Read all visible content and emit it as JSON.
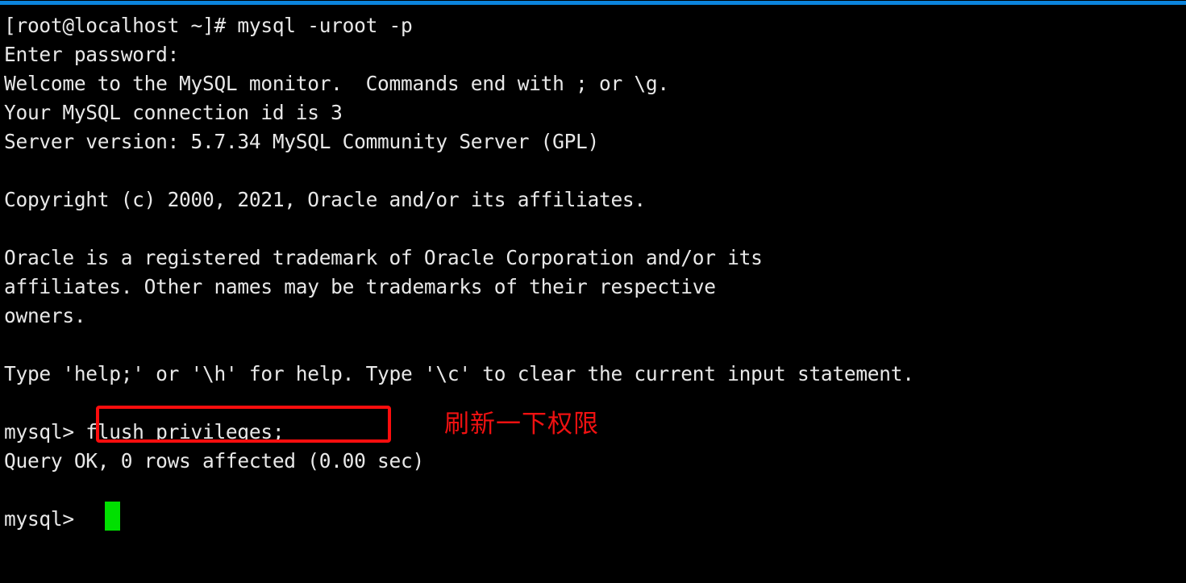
{
  "window": {
    "accent_color": "#0b84dd",
    "background_color": "#000000",
    "foreground_color": "#e8e8e8"
  },
  "terminal": {
    "prompt_shell": "[root@localhost ~]#",
    "command": "mysql -uroot -p",
    "lines": [
      {
        "id": "line-shell-prompt",
        "text": "[root@localhost ~]# mysql -uroot -p"
      },
      {
        "id": "line-enter-password",
        "text": "Enter password:"
      },
      {
        "id": "line-welcome",
        "text": "Welcome to the MySQL monitor.  Commands end with ; or \\g."
      },
      {
        "id": "line-connection-id",
        "text": "Your MySQL connection id is 3"
      },
      {
        "id": "line-server-version",
        "text": "Server version: 5.7.34 MySQL Community Server (GPL)"
      },
      {
        "id": "line-blank-1",
        "text": ""
      },
      {
        "id": "line-copyright",
        "text": "Copyright (c) 2000, 2021, Oracle and/or its affiliates."
      },
      {
        "id": "line-blank-2",
        "text": ""
      },
      {
        "id": "line-trademark-1",
        "text": "Oracle is a registered trademark of Oracle Corporation and/or its"
      },
      {
        "id": "line-trademark-2",
        "text": "affiliates. Other names may be trademarks of their respective"
      },
      {
        "id": "line-trademark-3",
        "text": "owners."
      },
      {
        "id": "line-blank-3",
        "text": ""
      },
      {
        "id": "line-help-hint",
        "text": "Type 'help;' or '\\h' for help. Type '\\c' to clear the current input statement."
      },
      {
        "id": "line-blank-4",
        "text": ""
      },
      {
        "id": "line-mysql-command",
        "text": "mysql> flush privileges;"
      },
      {
        "id": "line-query-result",
        "text": "Query OK, 0 rows affected (0.00 sec)"
      },
      {
        "id": "line-blank-5",
        "text": ""
      },
      {
        "id": "line-mysql-prompt-last",
        "text": "mysql>"
      }
    ]
  },
  "annotation": {
    "highlight_color": "#fc0d0d",
    "note_color": "#ef1111",
    "note_text": "刷新一下权限",
    "highlighted_command": "flush privileges;"
  },
  "cursor": {
    "color": "#00e000",
    "shape": "block"
  }
}
